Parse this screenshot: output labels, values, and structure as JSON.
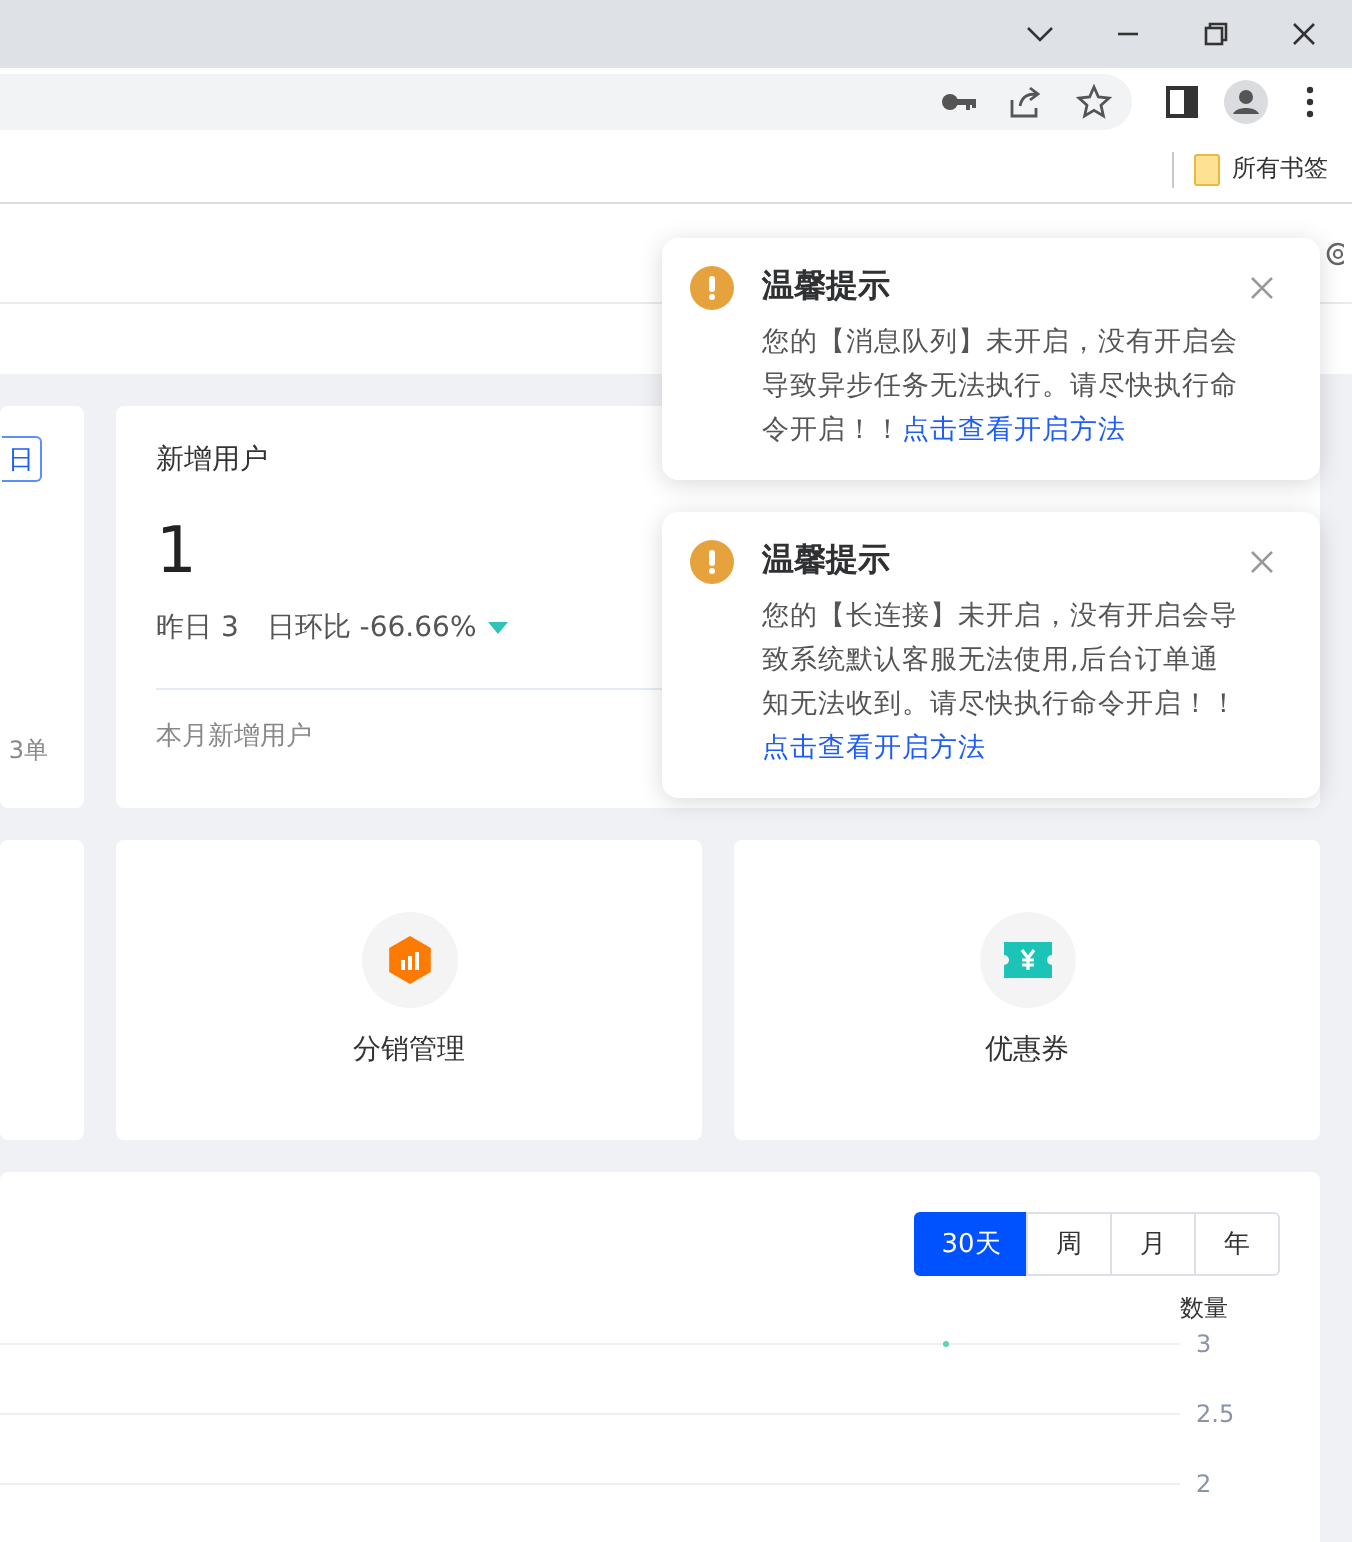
{
  "browser": {
    "bookmarks": [
      {
        "label": "所有书签"
      }
    ]
  },
  "notifications": [
    {
      "title": "温馨提示",
      "body": "您的【消息队列】未开启，没有开启会导致异步任务无法执行。请尽快执行命令开启！！",
      "link": "点击查看开启方法"
    },
    {
      "title": "温馨提示",
      "body": "您的【长连接】未开启，没有开启会导致系统默认客服无法使用,后台订单通知无法收到。请尽快执行命令开启！！",
      "link": "点击查看开启方法"
    }
  ],
  "stat_cards": [
    {
      "kind": "partial",
      "button": "日",
      "footer": "3单"
    },
    {
      "kind": "full",
      "title": "新增用户",
      "value": "1",
      "yesterday": "昨日 3",
      "change": "日环比 -66.66%",
      "down": true,
      "footer": "本月新增用户"
    }
  ],
  "shortcuts": [
    {
      "kind": "blank"
    },
    {
      "kind": "distribution",
      "label": "分销管理"
    },
    {
      "kind": "coupon",
      "label": "优惠券"
    }
  ],
  "chart": {
    "ranges": [
      {
        "label": "30天",
        "selected": true
      },
      {
        "label": "周",
        "selected": false
      },
      {
        "label": "月",
        "selected": false
      },
      {
        "label": "年",
        "selected": false
      }
    ],
    "chart_data": {
      "type": "scatter",
      "ylabel": "数量",
      "ylim": [
        2,
        3
      ],
      "yticks": [
        2,
        2.5,
        3
      ],
      "series": [
        {
          "color": "#5ad8a6",
          "values": [
            3
          ]
        }
      ]
    }
  }
}
